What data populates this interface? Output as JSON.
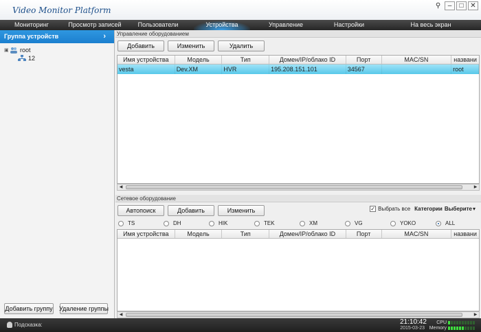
{
  "app": {
    "title": "Video Monitor Platform"
  },
  "window_controls": {
    "pin": "⚲",
    "minimize": "–",
    "maximize": "□",
    "close": "✕"
  },
  "nav": {
    "items": [
      "Мониторинг",
      "Просмотр записей",
      "Пользователи",
      "Устройства",
      "Управление",
      "Настройки"
    ],
    "fullscreen": "На весь экран"
  },
  "left": {
    "group_header": "Группа устройств",
    "chevron": "›",
    "tree": {
      "root": "root",
      "expand": "▣",
      "child": "12"
    },
    "add_group": "Добавить группу",
    "delete_group": "Удаление группы"
  },
  "managed": {
    "section_title": "Управление оборудованием",
    "buttons": {
      "add": "Добавить",
      "edit": "Изменить",
      "delete": "Удалить"
    },
    "columns": [
      "Имя устройства",
      "Модель",
      "Тип",
      "Домен/IP/облако ID",
      "Порт",
      "MAC/SN",
      "названи"
    ],
    "rows": [
      {
        "name": "vesta",
        "model": "Dev.XM",
        "type": "HVR",
        "address": "195.208.151.101",
        "port": "34567",
        "mac": "",
        "extra": "root"
      }
    ]
  },
  "network": {
    "section_title": "Сетевое оборудование",
    "buttons": {
      "autosearch": "Автопоиск",
      "add": "Добавить",
      "edit": "Изменить"
    },
    "select_all_checked": "✓",
    "select_all": "Выбрать все",
    "category_label": "Категории",
    "category_value": "Выберите",
    "dropdown_arrow": "▾",
    "protocols": [
      "TS",
      "DH",
      "HIK",
      "TEK",
      "XM",
      "VG",
      "YOKO",
      "ALL"
    ],
    "selected_protocol": "ALL",
    "columns": [
      "Имя устройства",
      "Модель",
      "Тип",
      "Домен/IP/облако ID",
      "Порт",
      "MAC/SN",
      "названи"
    ]
  },
  "status": {
    "hint": "Подсказка:",
    "time": "21:10:42",
    "date": "2015-03-23",
    "cpu_label": "CPU",
    "memory_label": "Memory",
    "cpu_level": 0.1,
    "memory_level": 0.6
  },
  "colors": {
    "accent": "#1b7fcf",
    "selection": "#58c8ea",
    "nav_bg": "#262626"
  }
}
